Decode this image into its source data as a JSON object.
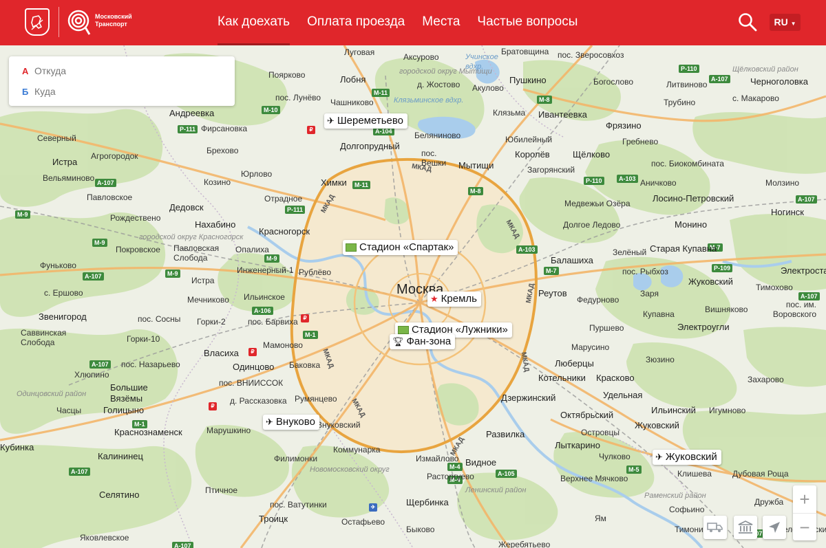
{
  "header": {
    "logo_text": "Московский Транспорт",
    "nav": [
      "Как доехать",
      "Оплата проезда",
      "Места",
      "Частые вопросы"
    ],
    "lang": "RU"
  },
  "route": {
    "from_letter": "А",
    "from_placeholder": "Откуда",
    "to_letter": "Б",
    "to_placeholder": "Куда"
  },
  "pois": {
    "sheremetyevo": "Шереметьево",
    "spartak": "Стадион «Спартак»",
    "kremlin": "Кремль",
    "luzhniki": "Стадион «Лужники»",
    "fanzone": "Фан-зона",
    "vnukovo": "Внуково",
    "zhukovsky": "Жуковский"
  },
  "colors": {
    "brand": "#e0262b"
  },
  "map_labels": {
    "moscow": "Москва",
    "lobnya": "Лобня",
    "lugovaya": "Луговая",
    "askurovo": "Аксурово",
    "uchinskoe": "Учинское вдхр.",
    "bratovshchina": "Братовщина",
    "zverosovkhoz": "пос. Зверосовхоз",
    "mytishchi_okrug": "городской округ Мытищи",
    "pushkino": "Пушкино",
    "shchelkovo_rayon": "Щёлковский район",
    "poyarkovo": "Поярково",
    "chashnikovo": "Чашниково",
    "zhostovo": "д. Жостово",
    "akulovo": "Акулово",
    "bogoslovo": "Богослово",
    "litvinovo": "Литвиново",
    "chernogolovka": "Черноголовка",
    "andreevka": "Андреевка",
    "pos_lunevo": "пос. Лунёво",
    "klyazminskoe": "Клязьминское вдхр.",
    "klyazma": "Клязьма",
    "ivanteevka": "Ивантеевка",
    "trubino": "Трубино",
    "makarovo": "с. Макарово",
    "firsanovka": "Фирсановка",
    "belyaninovo": "Беляниново",
    "yubileyny": "Юбилейный",
    "fryazino": "Фрязино",
    "severny": "Северный",
    "brekhovo": "Брехово",
    "dolgoprudny": "Долгопрудный",
    "greben": "Гребнево",
    "agrogorodok": "Агрогородок",
    "pos_veshki": "пос. Вешки",
    "korolev": "Королёв",
    "shchelkovo": "Щёлково",
    "istra": "Истра",
    "velyaminovo": "Вельяминово",
    "yurlovo": "Юрлово",
    "mytishchi": "Мытищи",
    "zagoryansky": "Загорянский",
    "biokombinat": "пос. Биокомбината",
    "khimki": "Химки",
    "kozino": "Козино",
    "anikovo": "Аничково",
    "molzino": "Молзино",
    "pavlovskoe": "Павловское",
    "otradnoe": "Отрадное",
    "medvezhi": "Медвежьи Озёра",
    "losino": "Лосино-Петровский",
    "dedovsk": "Дедовск",
    "noginsk": "Ногинск",
    "rozhdestveno": "Рождествено",
    "nakhabino": "Нахабино",
    "krasnogorsk": "Красногорск",
    "dolgoe_ledovo": "Долгое Ледово",
    "monino": "Монино",
    "krasnogorsk_okrug": "городской округ Красногорск",
    "pokrovskoe": "Покровское",
    "pavlovskaya_sloboda": "Павловская Слобода",
    "opalikha": "Опалиха",
    "zeleny": "Зелёный",
    "staraya_kupavna": "Старая Купавна",
    "balashikha": "Балашиха",
    "inzhenerny": "Инженерный-1",
    "fun_kovo": "Фуньково",
    "pos_rybkhoz": "пос. Рыбхоз",
    "zarya": "Заря",
    "elektrostal": "Электросталь",
    "istra2": "Истра",
    "rublevo": "Рублёво",
    "zhukovsky_town": "Жуковский",
    "timokhovo": "Тимохово",
    "ershovo": "с. Ершово",
    "ilinskoe": "Ильинское",
    "reutov": "Реутов",
    "fedurnovo": "Федурново",
    "vishnyakovo": "Вишняково",
    "zvenigorod": "Звенигород",
    "mechnikovo": "Мечниково",
    "pos_im_vorovskogo": "пос. им. Воровского",
    "pos_sosny": "пос. Сосны",
    "gorki2": "Горки-2",
    "pos_barvikha": "пос. Барвиха",
    "kupavna": "Купавна",
    "elektrougli": "Электроугли",
    "savvinskaya_sloboda": "Саввинская Слобода",
    "gorki10": "Горки-10",
    "mamonovo": "Мамоново",
    "pursheevo": "Пуршево",
    "vlasikha": "Власиха",
    "odintsovo": "Одинцово",
    "marusino": "Марусино",
    "pos_nazarevo": "пос. Назарьево",
    "bakovka": "Баковка",
    "zyuzino": "Зюзино",
    "lyubertsy": "Люберцы",
    "khlyupino": "Хлюпино",
    "pos_vniissok": "пос. ВНИИССОК",
    "kotelniki": "Котельники",
    "kraskovo": "Красково",
    "zakharovo": "Захарово",
    "odintsovsky_rayon": "Одинцовский район",
    "bolshie_vyazemy": "Большие Вязёмы",
    "d_rasskazovka": "д. Рассказовка",
    "rumyantsevo": "Румянцево",
    "dzerzhinsky": "Дзержинский",
    "udelnaya": "Удельная",
    "chastsy": "Часцы",
    "golitsyno": "Голицыно",
    "oktyabrsky": "Октябрьский",
    "ilinsky": "Ильинский",
    "igumnovo": "Игумново",
    "marushkino": "Марушкино",
    "vnukovsky": "Внуковский",
    "krasnoznamensk": "Краснознаменск",
    "razvilka": "Развилка",
    "ostrovtsy": "Островцы",
    "zhukovsky_bold": "Жуковский",
    "kommunarka": "Коммунарка",
    "kubinka": "Кубинка",
    "kalininets": "Калининец",
    "filimonki": "Филимонки",
    "izmailovo": "Измайлово",
    "vidnoe": "Видное",
    "lytkarino": "Лыткарино",
    "chulkovo": "Чулково",
    "novomoskovsky": "Новомосковский округ",
    "rastorguevo": "Расторгуево",
    "verkhnee_myachkovo": "Верхнее Мячково",
    "klishcheva": "Клишева",
    "dubovaya_rosha": "Дубовая Роща",
    "selyatino": "Селятино",
    "ptichnoe": "Птичное",
    "leninsky_rayon": "Ленинский район",
    "ramensky_rayon": "Раменский район",
    "druzhba": "Дружба",
    "pos_vatutinki": "пос. Ватутинки",
    "shcherbinka": "Щербинка",
    "fosfo": "Софьино",
    "troitsk": "Троицк",
    "ostafyevo": "Остафьево",
    "yam": "Ям",
    "timonino": "Тимонино",
    "belozerskiy": "Белоозерский",
    "yakovlevskoe": "Яковлевское",
    "bykovo": "Быково",
    "zherebtsovo": "Жеребятьево"
  }
}
